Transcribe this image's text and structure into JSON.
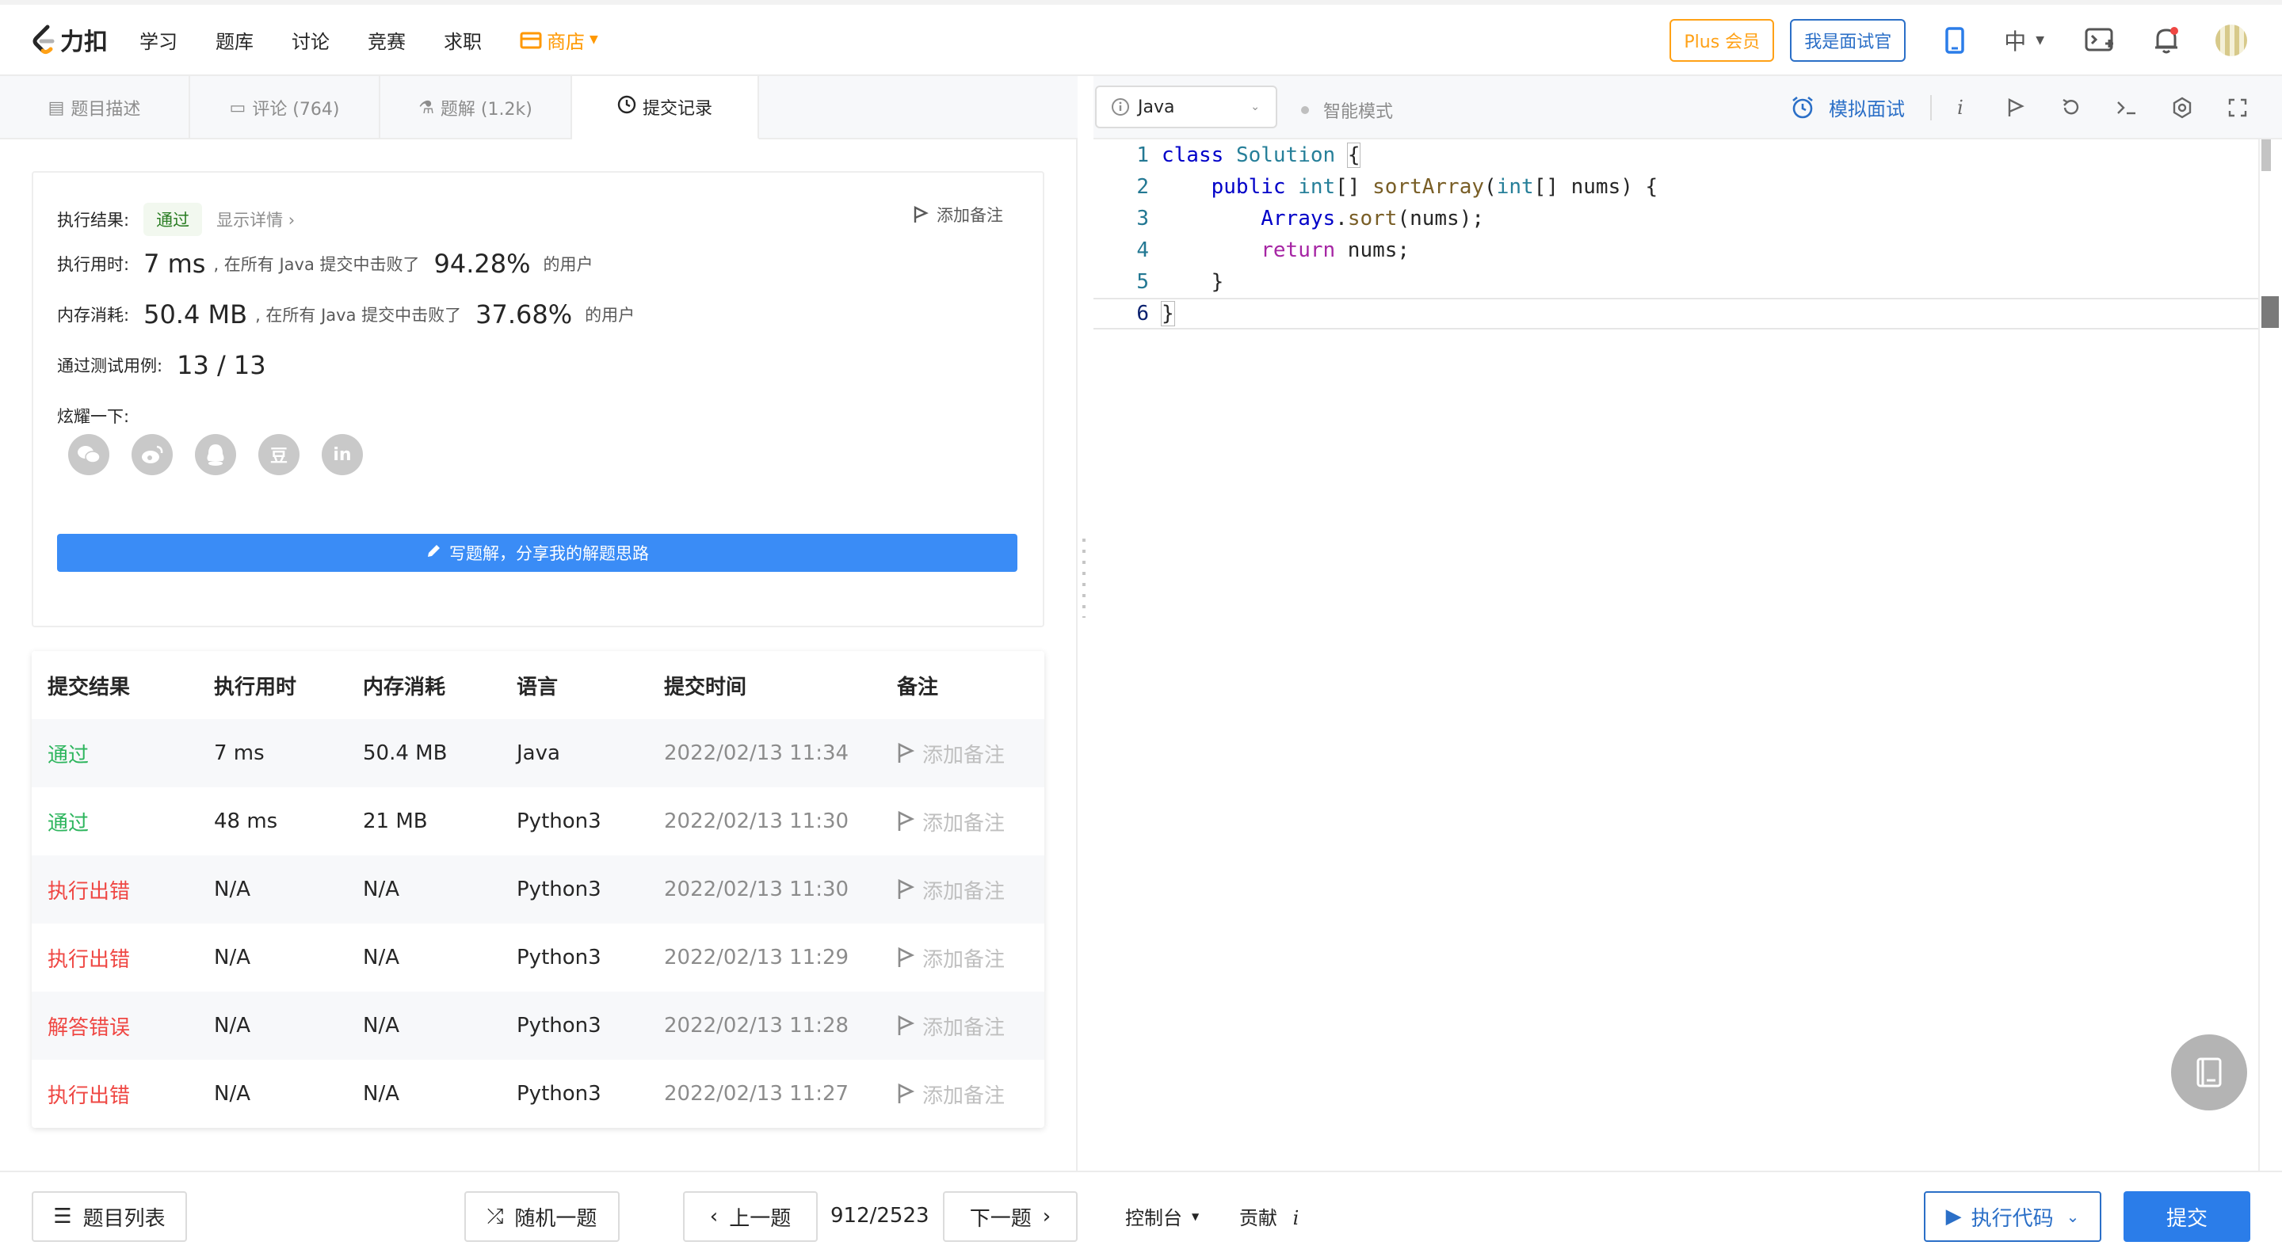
{
  "nav": {
    "logo_text": "力扣",
    "links": [
      "学习",
      "题库",
      "讨论",
      "竞赛",
      "求职"
    ],
    "shop": "商店",
    "plus_label": "Plus 会员",
    "interviewer_label": "我是面试官",
    "lang": "中"
  },
  "left_tabs": [
    {
      "label": "题目描述",
      "icon": "document-icon"
    },
    {
      "label": "评论 (764)",
      "icon": "comment-icon"
    },
    {
      "label": "题解 (1.2k)",
      "icon": "flask-icon"
    },
    {
      "label": "提交记录",
      "icon": "clock-icon"
    }
  ],
  "result": {
    "exec_result_label": "执行结果:",
    "status": "通过",
    "detail_link": "显示详情",
    "add_note": "添加备注",
    "time_label": "执行用时:",
    "time_value": "7 ms",
    "time_text": ", 在所有 Java 提交中击败了",
    "time_percent": "94.28%",
    "users_text": "的用户",
    "mem_label": "内存消耗:",
    "mem_value": "50.4 MB",
    "mem_text": ", 在所有 Java 提交中击败了",
    "mem_percent": "37.68%",
    "cases_label": "通过测试用例:",
    "cases_value": "13 / 13",
    "share_label": "炫耀一下:",
    "share_icons": [
      "wechat-icon",
      "weibo-icon",
      "qq-icon",
      "douban-icon",
      "linkedin-icon"
    ],
    "douban_glyph": "豆",
    "linkedin_glyph": "in",
    "write_solution": "写题解，分享我的解题思路"
  },
  "table": {
    "headers": [
      "提交结果",
      "执行用时",
      "内存消耗",
      "语言",
      "提交时间",
      "备注"
    ],
    "note_label": "添加备注",
    "rows": [
      {
        "status": "通过",
        "kind": "pass",
        "time": "7 ms",
        "memory": "50.4 MB",
        "lang": "Java",
        "submitted": "2022/02/13 11:34"
      },
      {
        "status": "通过",
        "kind": "pass",
        "time": "48 ms",
        "memory": "21 MB",
        "lang": "Python3",
        "submitted": "2022/02/13 11:30"
      },
      {
        "status": "执行出错",
        "kind": "err",
        "time": "N/A",
        "memory": "N/A",
        "lang": "Python3",
        "submitted": "2022/02/13 11:30"
      },
      {
        "status": "执行出错",
        "kind": "err",
        "time": "N/A",
        "memory": "N/A",
        "lang": "Python3",
        "submitted": "2022/02/13 11:29"
      },
      {
        "status": "解答错误",
        "kind": "err",
        "time": "N/A",
        "memory": "N/A",
        "lang": "Python3",
        "submitted": "2022/02/13 11:28"
      },
      {
        "status": "执行出错",
        "kind": "err",
        "time": "N/A",
        "memory": "N/A",
        "lang": "Python3",
        "submitted": "2022/02/13 11:27"
      }
    ]
  },
  "editor": {
    "language": "Java",
    "smart_mode": "智能模式",
    "mock_interview": "模拟面试",
    "line_numbers": [
      "1",
      "2",
      "3",
      "4",
      "5",
      "6"
    ],
    "code": {
      "l1_kw": "class",
      "l1_name": "Solution",
      "l1_brace": "{",
      "l2_indent": "    ",
      "l2_kw": "public",
      "l2_type": "int",
      "l2_arr": "[] ",
      "l2_fn": "sortArray",
      "l2_open": "(",
      "l2_ptype": "int",
      "l2_rest": "[] nums) {",
      "l3_indent": "        ",
      "l3_obj": "Arrays",
      "l3_dot": ".",
      "l3_fn": "sort",
      "l3_rest": "(nums);",
      "l4_indent": "        ",
      "l4_kw": "return",
      "l4_rest": " nums;",
      "l5": "    }",
      "l6": "}"
    }
  },
  "bottom": {
    "problem_list": "题目列表",
    "random": "随机一题",
    "prev": "上一题",
    "pager": "912/2523",
    "next": "下一题",
    "console": "控制台",
    "contribute": "贡献",
    "contribute_icon": "i",
    "run": "执行代码",
    "submit": "提交"
  },
  "colors": {
    "pass": "#2db55d",
    "error": "#ef4743",
    "accent": "#2b7de9",
    "plus": "#ffa116"
  }
}
